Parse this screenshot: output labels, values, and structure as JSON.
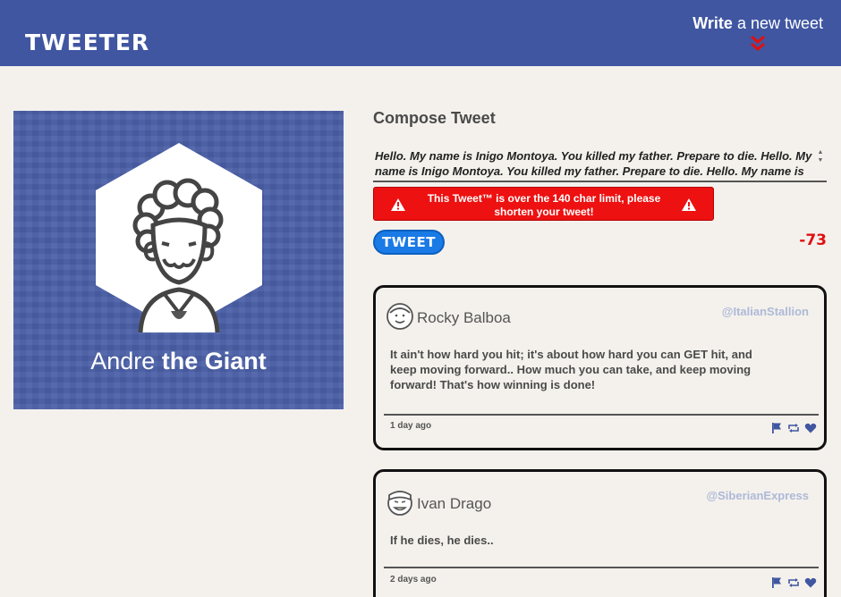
{
  "header": {
    "brand": "TWEETER",
    "write_bold": "Write",
    "write_rest": " a new tweet"
  },
  "profile": {
    "name_first": "Andre",
    "name_rest": " the Giant"
  },
  "compose": {
    "title": "Compose Tweet",
    "text": "Hello. My name is Inigo Montoya. You killed my father. Prepare to die. Hello. My name is Inigo Montoya. You killed my father. Prepare to die. Hello. My name is Inigo Montoya. You killed my father. Prepare to die.",
    "error_message": "This Tweet™ is over the 140 char limit, please shorten your tweet!",
    "button_label": "TWEET",
    "counter": "-73"
  },
  "tweets": [
    {
      "author": "Rocky Balboa",
      "handle": "@ItalianStallion",
      "body": "It ain't how hard you hit; it's about how hard you can GET hit, and keep moving forward.. How much you can take, and keep moving forward! That's how winning is done!",
      "timestamp": "1 day ago"
    },
    {
      "author": "Ivan Drago",
      "handle": "@SiberianExpress",
      "body": "If he dies, he dies..",
      "timestamp": "2 days ago"
    }
  ],
  "colors": {
    "nav": "#4056a1",
    "background": "#f4f1ec",
    "error": "#ee1111",
    "button": "#1a7ae6",
    "counter": "#e01010"
  }
}
